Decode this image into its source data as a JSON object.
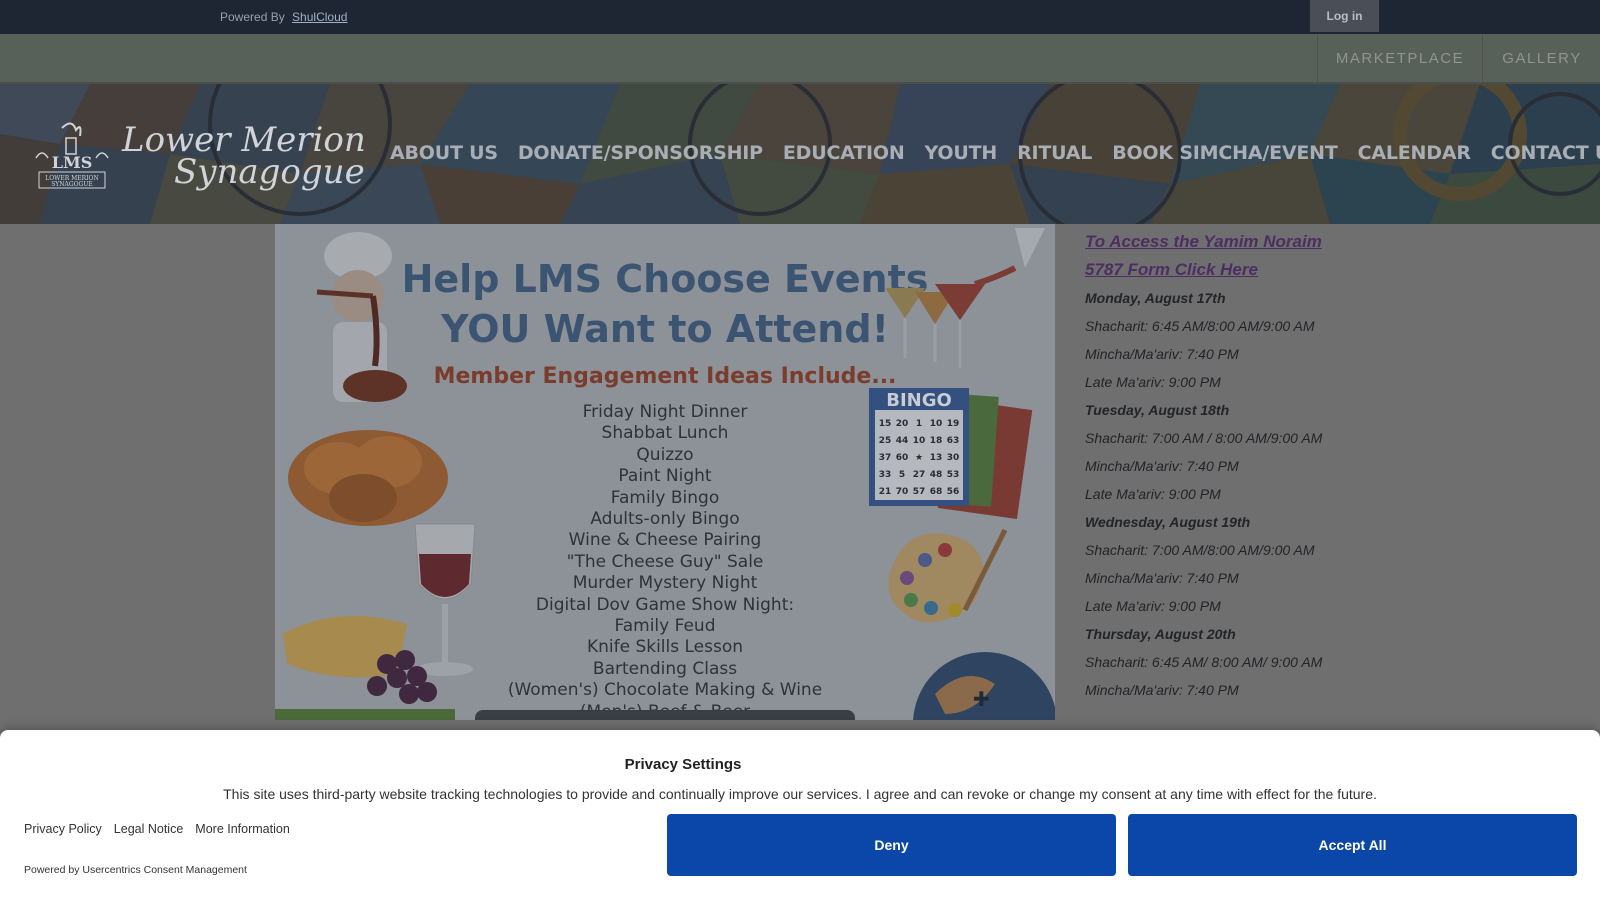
{
  "topbar": {
    "powered_by": "Powered By",
    "shulcloud": "ShulCloud",
    "login": "Log in"
  },
  "secondary_nav": [
    {
      "label": "MARKETPLACE"
    },
    {
      "label": "GALLERY"
    }
  ],
  "logo": {
    "initials": "LMS",
    "subtitle": "LOWER MERION SYNAGOGUE",
    "word1": "Lower Merion",
    "word2": "Synagogue"
  },
  "main_nav": [
    {
      "label": "ABOUT US"
    },
    {
      "label": "DONATE/SPONSORSHIP"
    },
    {
      "label": "EDUCATION"
    },
    {
      "label": "YOUTH"
    },
    {
      "label": "RITUAL"
    },
    {
      "label": "BOOK SIMCHA/EVENT"
    },
    {
      "label": "CALENDAR"
    },
    {
      "label": "CONTACT US"
    }
  ],
  "flyer": {
    "title_line1": "Help LMS Choose Events",
    "title_line2": "YOU Want to Attend!",
    "subtitle": "Member Engagement Ideas Include...",
    "items": [
      "Friday Night Dinner",
      "Shabbat Lunch",
      "Quizzo",
      "Paint Night",
      "Family Bingo",
      "Adults-only Bingo",
      "Wine & Cheese Pairing",
      "\"The Cheese Guy\" Sale",
      "Murder Mystery Night",
      "Digital Dov Game Show Night:",
      "Family Feud",
      "Knife Skills Lesson",
      "Bartending Class",
      "(Women's) Chocolate Making & Wine",
      "(Men's) Beef & Beer"
    ],
    "bingo_label": "BINGO",
    "bingo_numbers": [
      "15",
      "20",
      "1",
      "10",
      "19",
      "25",
      "44",
      "10",
      "18",
      "63",
      "37",
      "60",
      "★",
      "13",
      "30",
      "33",
      "5",
      "27",
      "48",
      "53",
      "21",
      "70",
      "57",
      "68",
      "56"
    ]
  },
  "schedule": {
    "link_text": "To Access the Yamim Noraim 5787 Form Click Here",
    "lines": [
      {
        "text": "Monday, August 17th",
        "day": true
      },
      {
        "text": "Shacharit: 6:45 AM/8:00 AM/9:00 AM",
        "day": false
      },
      {
        "text": "Mincha/Ma'ariv: 7:40 PM",
        "day": false
      },
      {
        "text": "Late Ma'ariv: 9:00 PM",
        "day": false
      },
      {
        "text": " Tuesday, August 18th",
        "day": true
      },
      {
        "text": "Shacharit: 7:00 AM / 8:00 AM/9:00 AM",
        "day": false
      },
      {
        "text": "Mincha/Ma'ariv: 7:40 PM",
        "day": false
      },
      {
        "text": "Late Ma'ariv: 9:00 PM",
        "day": false
      },
      {
        "text": " Wednesday, August 19th",
        "day": true
      },
      {
        "text": "Shacharit: 7:00 AM/8:00 AM/9:00 AM",
        "day": false
      },
      {
        "text": "Mincha/Ma'ariv: 7:40 PM",
        "day": false
      },
      {
        "text": "Late Ma'ariv: 9:00 PM",
        "day": false
      },
      {
        "text": " Thursday, August 20th",
        "day": true
      },
      {
        "text": "Shacharit: 6:45 AM/ 8:00 AM/ 9:00 AM",
        "day": false
      },
      {
        "text": "Mincha/Ma'ariv: 7:40 PM",
        "day": false
      }
    ]
  },
  "privacy": {
    "title": "Privacy Settings",
    "text": "This site uses third-party website tracking technologies to provide and continually improve our services. I agree and can revoke or change my consent at any time with effect for the future.",
    "links": [
      "Privacy Policy",
      "Legal Notice",
      "More Information"
    ],
    "powered_by": "Powered by Usercentrics Consent Management",
    "deny": "Deny",
    "accept": "Accept All"
  },
  "colors": {
    "accept_button": "#0b47a8",
    "topbar": "#1f2633",
    "link": "#4d2e63"
  }
}
